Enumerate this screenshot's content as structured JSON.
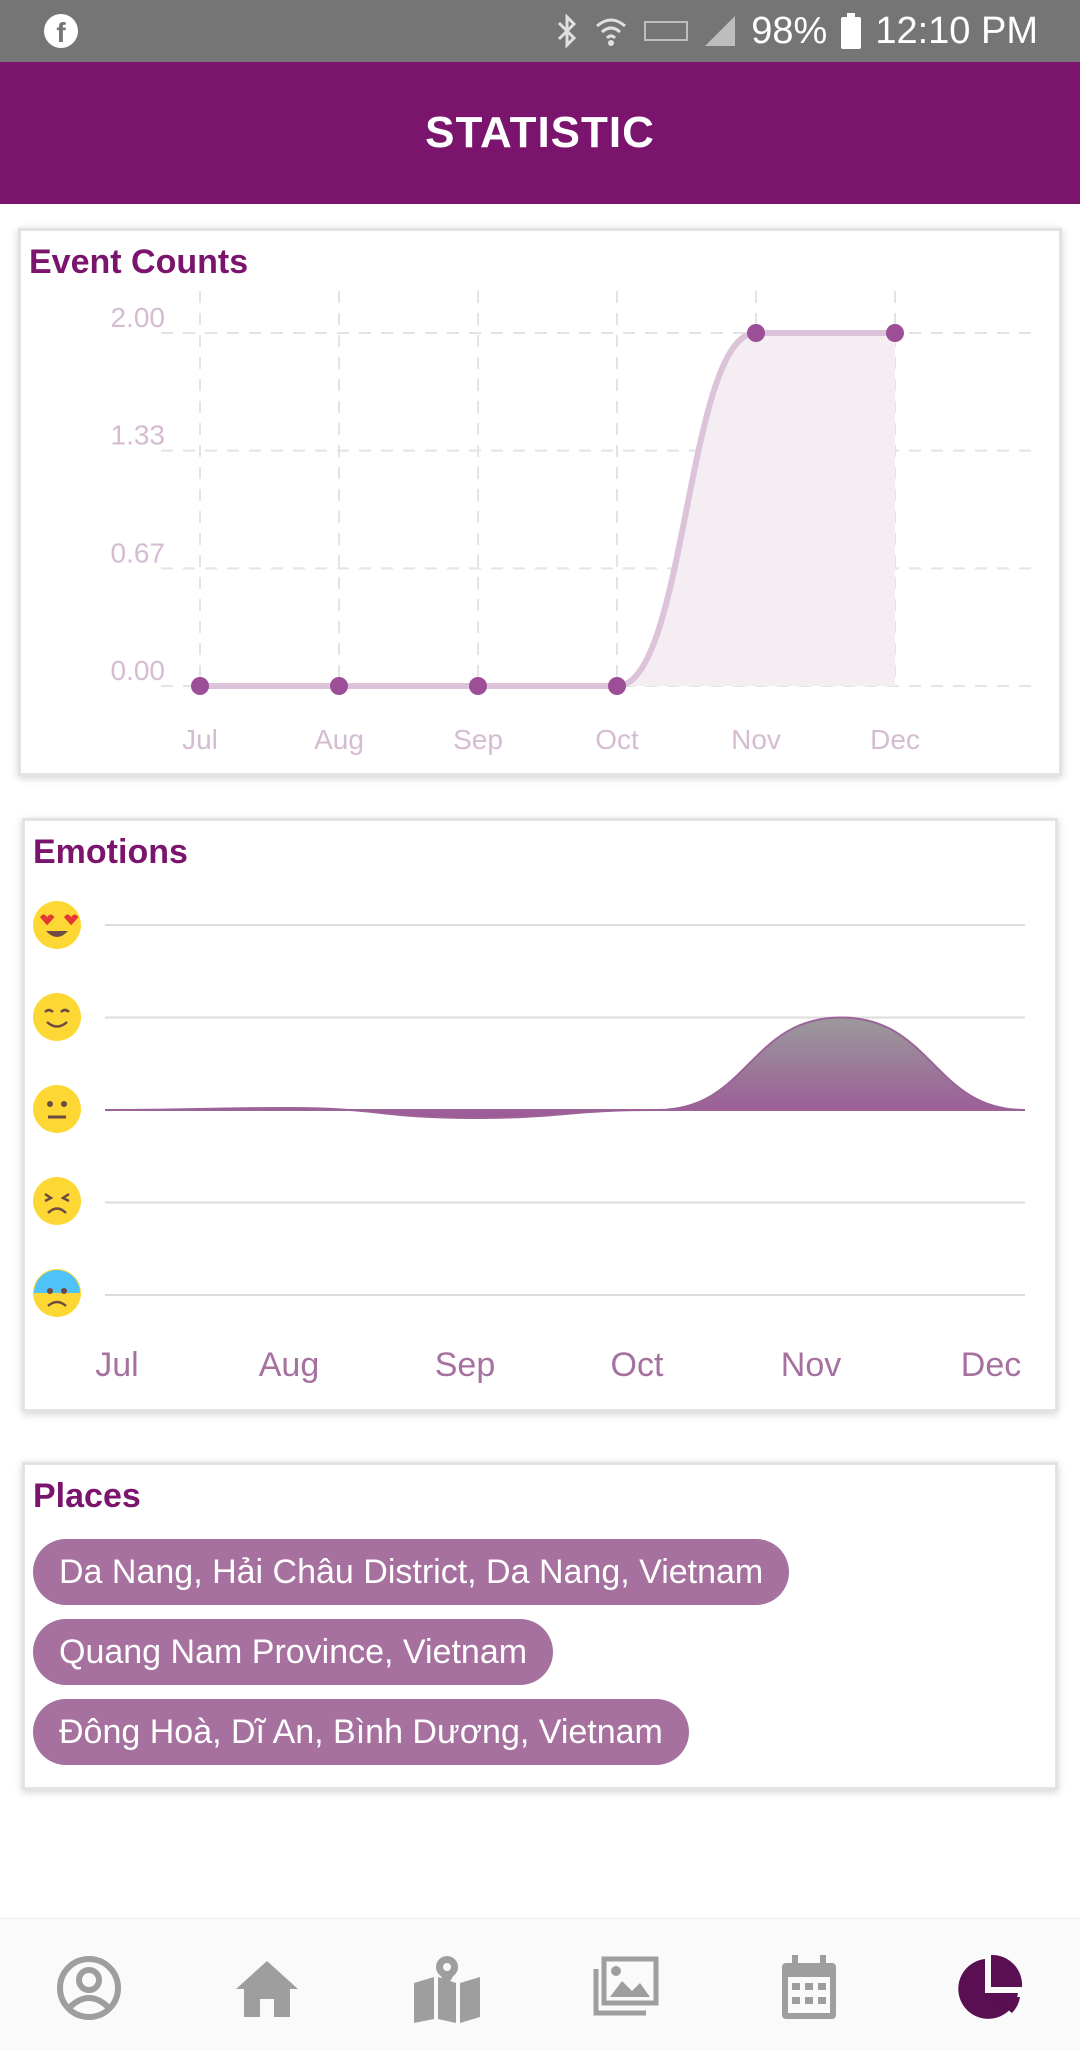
{
  "status_bar": {
    "battery": "98%",
    "time": "12:10 PM"
  },
  "app_bar": {
    "title": "STATISTIC"
  },
  "event_counts": {
    "title": "Event Counts",
    "chart_data": {
      "type": "line",
      "categories": [
        "Jul",
        "Aug",
        "Sep",
        "Oct",
        "Nov",
        "Dec"
      ],
      "values": [
        0,
        0,
        0,
        0,
        2,
        2
      ],
      "yticks": [
        "2.00",
        "1.33",
        "0.67",
        "0.00"
      ],
      "ylim": [
        0,
        2
      ],
      "grid": true,
      "color": "#9c4f96"
    }
  },
  "emotions": {
    "title": "Emotions",
    "levels": [
      "heart-eyes-emoji-icon",
      "smiling-emoji-icon",
      "neutral-emoji-icon",
      "sad-emoji-icon",
      "crying-emoji-icon"
    ],
    "chart_data": {
      "type": "area",
      "categories": [
        "Jul",
        "Aug",
        "Sep",
        "Oct",
        "Nov",
        "Dec"
      ],
      "values": [
        0,
        0,
        0,
        0,
        1,
        0
      ],
      "ylim": [
        -2,
        2
      ],
      "color": "#9c6398"
    }
  },
  "places": {
    "title": "Places",
    "items": [
      "Da Nang, Hải Châu District, Da Nang, Vietnam",
      "Quang Nam Province, Vietnam",
      "Đông Hoà, Dĩ An, Bình Dương, Vietnam"
    ]
  },
  "bottom_nav": {
    "items": [
      "profile-icon",
      "home-icon",
      "map-icon",
      "gallery-icon",
      "calendar-icon",
      "statistic-icon"
    ],
    "active": "statistic-icon"
  }
}
